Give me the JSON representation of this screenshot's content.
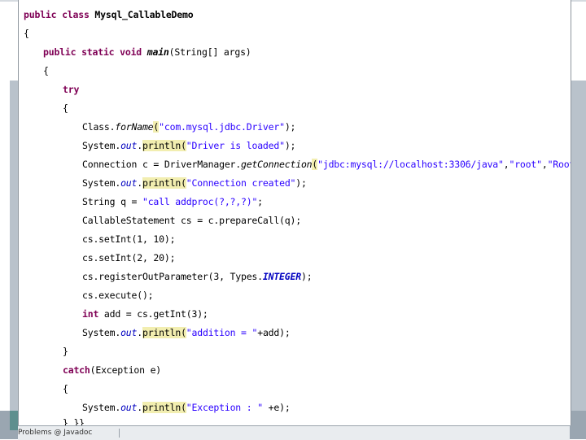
{
  "editor": {
    "line1": {
      "a": "public class ",
      "b": "Mysql_CallableDemo"
    },
    "line2": "{",
    "line3": {
      "a": "public static void ",
      "b": "main",
      "c": "(String[] args)"
    },
    "line4": "{",
    "line5": "try",
    "line6": "{",
    "line7": {
      "a": "Class.",
      "b": "forName",
      "c": "(",
      "d": "\"com.mysql.jdbc.Driver\"",
      "e": ");"
    },
    "line8": {
      "a": "System.",
      "b": "out",
      "c": ".",
      "d": "println",
      "e": "(",
      "f": "\"Driver is loaded\"",
      "g": ");"
    },
    "line9": {
      "a": "Connection c = DriverManager.",
      "b": "getConnection",
      "c": "(",
      "d": "\"jdbc:mysql://localhost:3306/java\"",
      "e": ",",
      "f": "\"root\"",
      "g": ",",
      "h": "\"Root\"",
      "i": ");"
    },
    "line10": {
      "a": "System.",
      "b": "out",
      "c": ".",
      "d": "println",
      "e": "(",
      "f": "\"Connection created\"",
      "g": ");"
    },
    "line11": {
      "a": "String q = ",
      "b": "\"call addproc(?,?,?)\"",
      "c": ";"
    },
    "line12": "CallableStatement cs = c.prepareCall(q);",
    "line13": "cs.setInt(1, 10);",
    "line14": "cs.setInt(2, 20);",
    "line15": {
      "a": "cs.registerOutParameter(3, Types.",
      "b": "INTEGER",
      "c": ");"
    },
    "line16": "cs.execute();",
    "line17": {
      "a": "int",
      "b": " add = cs.getInt(3);"
    },
    "line18": {
      "a": "System.",
      "b": "out",
      "c": ".",
      "d": "println",
      "e": "(",
      "f": "\"addition = \"",
      "g": "+add);"
    },
    "line19": "}",
    "line20": {
      "a": "catch",
      "b": "(Exception e)"
    },
    "line21": "{",
    "line22": {
      "a": "System.",
      "b": "out",
      "c": ".",
      "d": "println",
      "e": "(",
      "f": "\"Exception : \"",
      "g": " +e);"
    },
    "line23": "} }}"
  },
  "status": {
    "tab_fragment": "Problems  @ Javadoc"
  },
  "colors": {
    "keyword": "#7f0055",
    "string": "#2a00ff",
    "field": "#0000c0",
    "highlight": "#f2eeb0",
    "frame": "#b9c2cb"
  }
}
